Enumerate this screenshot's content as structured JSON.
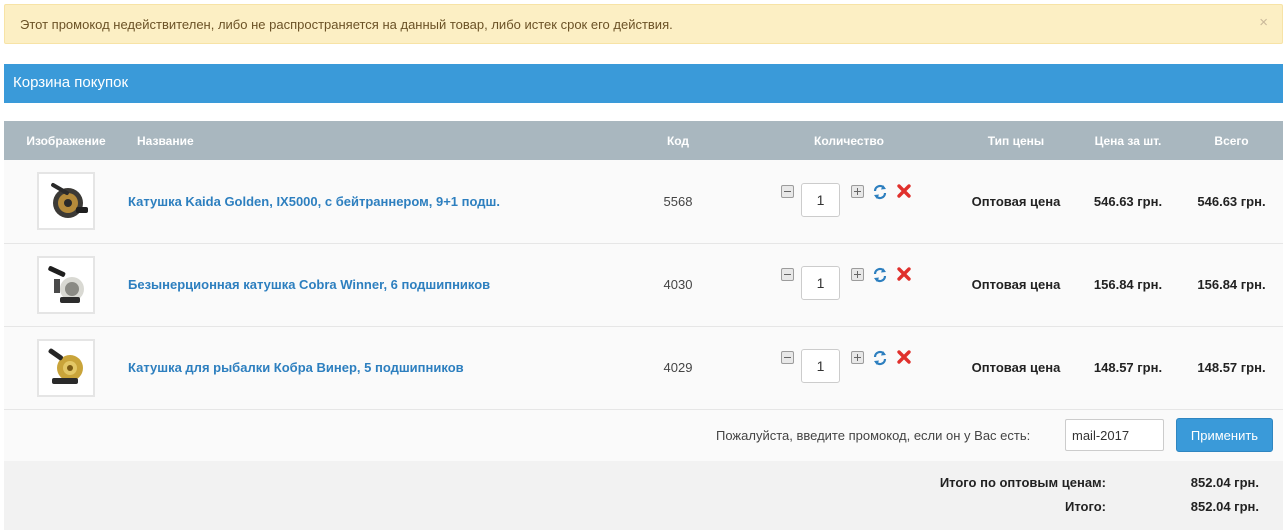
{
  "alert": {
    "message": "Этот промокод недействителен, либо не распространяется на данный товар, либо истек срок его действия.",
    "close": "×"
  },
  "panel": {
    "title": "Корзина покупок"
  },
  "table": {
    "headers": {
      "image": "Изображение",
      "name": "Название",
      "code": "Код",
      "quantity": "Количество",
      "price_type": "Тип цены",
      "unit_price": "Цена за шт.",
      "total": "Всего"
    },
    "rows": [
      {
        "name": "Катушка Kaida Golden, IX5000, с бейтраннером, 9+1 подш.",
        "code": "5568",
        "qty": "1",
        "price_type": "Оптовая цена",
        "unit_price": "546.63 грн.",
        "total": "546.63 грн."
      },
      {
        "name": "Безынерционная катушка Cobra Winner, 6 подшипников",
        "code": "4030",
        "qty": "1",
        "price_type": "Оптовая цена",
        "unit_price": "156.84 грн.",
        "total": "156.84 грн."
      },
      {
        "name": "Катушка для рыбалки Кобра Винер, 5 подшипников",
        "code": "4029",
        "qty": "1",
        "price_type": "Оптовая цена",
        "unit_price": "148.57 грн.",
        "total": "148.57 грн."
      }
    ]
  },
  "promo": {
    "label": "Пожалуйста, введите промокод, если он у Вас есть:",
    "value": "mail-2017",
    "button": "Применить"
  },
  "totals": {
    "wholesale_label": "Итого по оптовым ценам:",
    "wholesale_value": "852.04 грн.",
    "grand_label": "Итого:",
    "grand_value": "852.04 грн."
  },
  "colors": {
    "accent": "#3a9ad9",
    "header_bg": "#a9b7bf",
    "link": "#2d7fbf",
    "alert_bg": "#fcefc4",
    "remove": "#e0302c"
  },
  "icons": {
    "minus": "minus-icon",
    "plus": "plus-icon",
    "refresh": "refresh-icon",
    "remove": "remove-icon"
  }
}
